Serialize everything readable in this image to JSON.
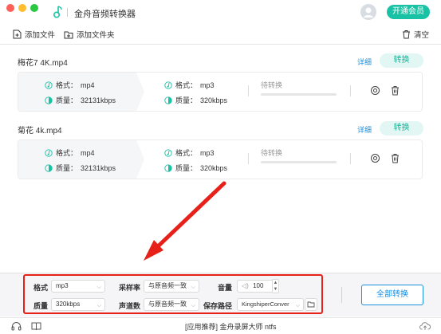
{
  "app": {
    "title": "金舟音频转换器",
    "vip_button": "开通会员"
  },
  "toolbar": {
    "add_file": "添加文件",
    "add_folder": "添加文件夹",
    "clear": "清空"
  },
  "files": [
    {
      "name": "梅花7 4K.mp4",
      "detail": "详细",
      "convert": "转换",
      "src_format_label": "格式：",
      "src_format": "mp4",
      "src_quality_label": "质量：",
      "src_quality": "32131kbps",
      "dst_format_label": "格式：",
      "dst_format": "mp3",
      "dst_quality_label": "质量：",
      "dst_quality": "320kbps",
      "status": "待转换",
      "progress": 0
    },
    {
      "name": "菊花 4k.mp4",
      "detail": "详细",
      "convert": "转换",
      "src_format_label": "格式：",
      "src_format": "mp4",
      "src_quality_label": "质量：",
      "src_quality": "32131kbps",
      "dst_format_label": "格式：",
      "dst_format": "mp3",
      "dst_quality_label": "质量：",
      "dst_quality": "320kbps",
      "status": "待转换",
      "progress": 0
    }
  ],
  "settings": {
    "format_label": "格式",
    "format_value": "mp3",
    "quality_label": "质量",
    "quality_value": "320kbps",
    "samplerate_label": "采样率",
    "samplerate_value": "与原音频一致",
    "channels_label": "声道数",
    "channels_value": "与原音频一致",
    "volume_label": "音量",
    "volume_value": "100",
    "savepath_label": "保存路径",
    "savepath_value": "KingshiperConver",
    "convert_all": "全部转换"
  },
  "statusbar": {
    "promo": "[应用推荐]  金舟录屏大师   ntfs"
  },
  "colors": {
    "accent": "#19c2a5",
    "link": "#1b8fe0",
    "highlight": "#e8201a"
  }
}
